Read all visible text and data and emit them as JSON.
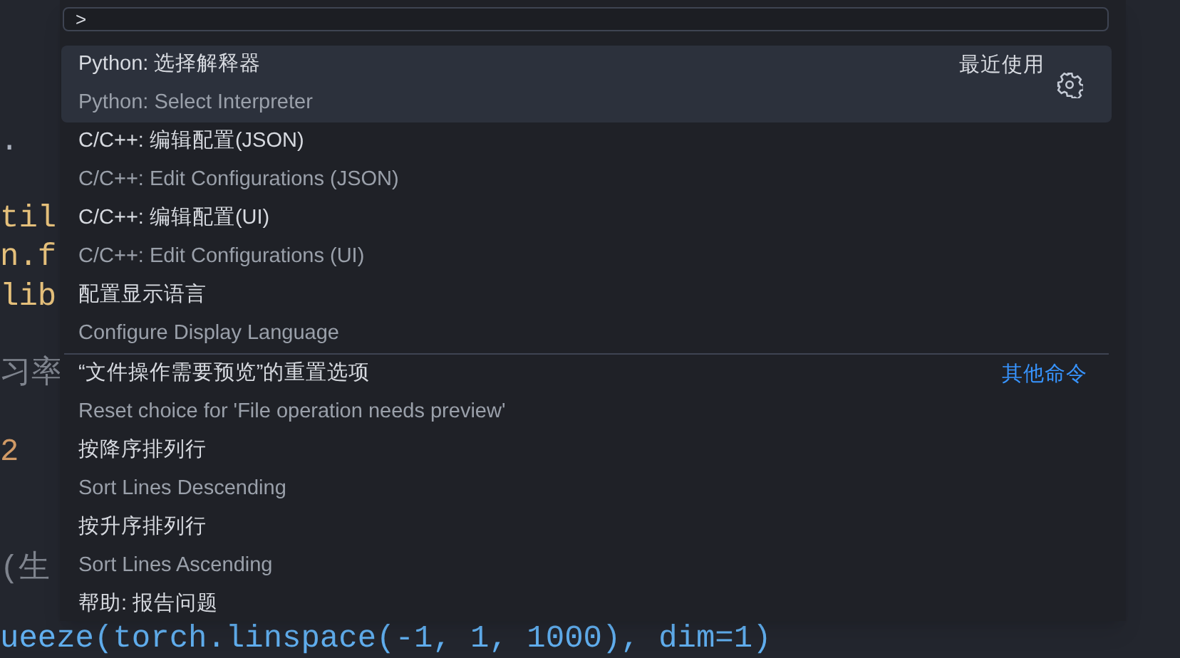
{
  "editor": {
    "code_lines": [
      {
        "kind": "blank"
      },
      {
        "kind": "blank"
      },
      {
        "kind": "blank"
      },
      {
        "text": ".",
        "kind": "plain"
      },
      {
        "kind": "blank"
      },
      {
        "text": "til",
        "kind": "module"
      },
      {
        "text": "n.f",
        "kind": "module"
      },
      {
        "text": "lib",
        "kind": "module"
      },
      {
        "kind": "blank"
      },
      {
        "text": "习率",
        "kind": "comment"
      },
      {
        "kind": "blank"
      },
      {
        "text": "2",
        "kind": "number"
      },
      {
        "kind": "blank"
      },
      {
        "kind": "blank"
      },
      {
        "text": "(生",
        "kind": "comment"
      }
    ],
    "bottom_line": "ueeze(torch.linspace(-1, 1, 1000), dim=1)"
  },
  "command_palette": {
    "input": {
      "value": ">"
    },
    "items": [
      {
        "label": "Python: 选择解释器",
        "detail": "Python: Select Interpreter",
        "selected": true,
        "separator_above": false,
        "group": {
          "label": "最近使用",
          "kind": "recent"
        }
      },
      {
        "label": "C/C++: 编辑配置(JSON)",
        "detail": "C/C++: Edit Configurations (JSON)",
        "selected": false,
        "separator_above": false
      },
      {
        "label": "C/C++: 编辑配置(UI)",
        "detail": "C/C++: Edit Configurations (UI)",
        "selected": false,
        "separator_above": false
      },
      {
        "label": "配置显示语言",
        "detail": "Configure Display Language",
        "selected": false,
        "separator_above": false
      },
      {
        "label": "“文件操作需要预览”的重置选项",
        "detail": "Reset choice for 'File operation needs preview'",
        "selected": false,
        "separator_above": true,
        "group": {
          "label": "其他命令",
          "kind": "other"
        }
      },
      {
        "label": "按降序排列行",
        "detail": "Sort Lines Descending",
        "selected": false,
        "separator_above": false
      },
      {
        "label": "按升序排列行",
        "detail": "Sort Lines Ascending",
        "selected": false,
        "separator_above": false
      },
      {
        "label": "帮助: 报告问题",
        "selected": false,
        "separator_above": false
      }
    ]
  }
}
